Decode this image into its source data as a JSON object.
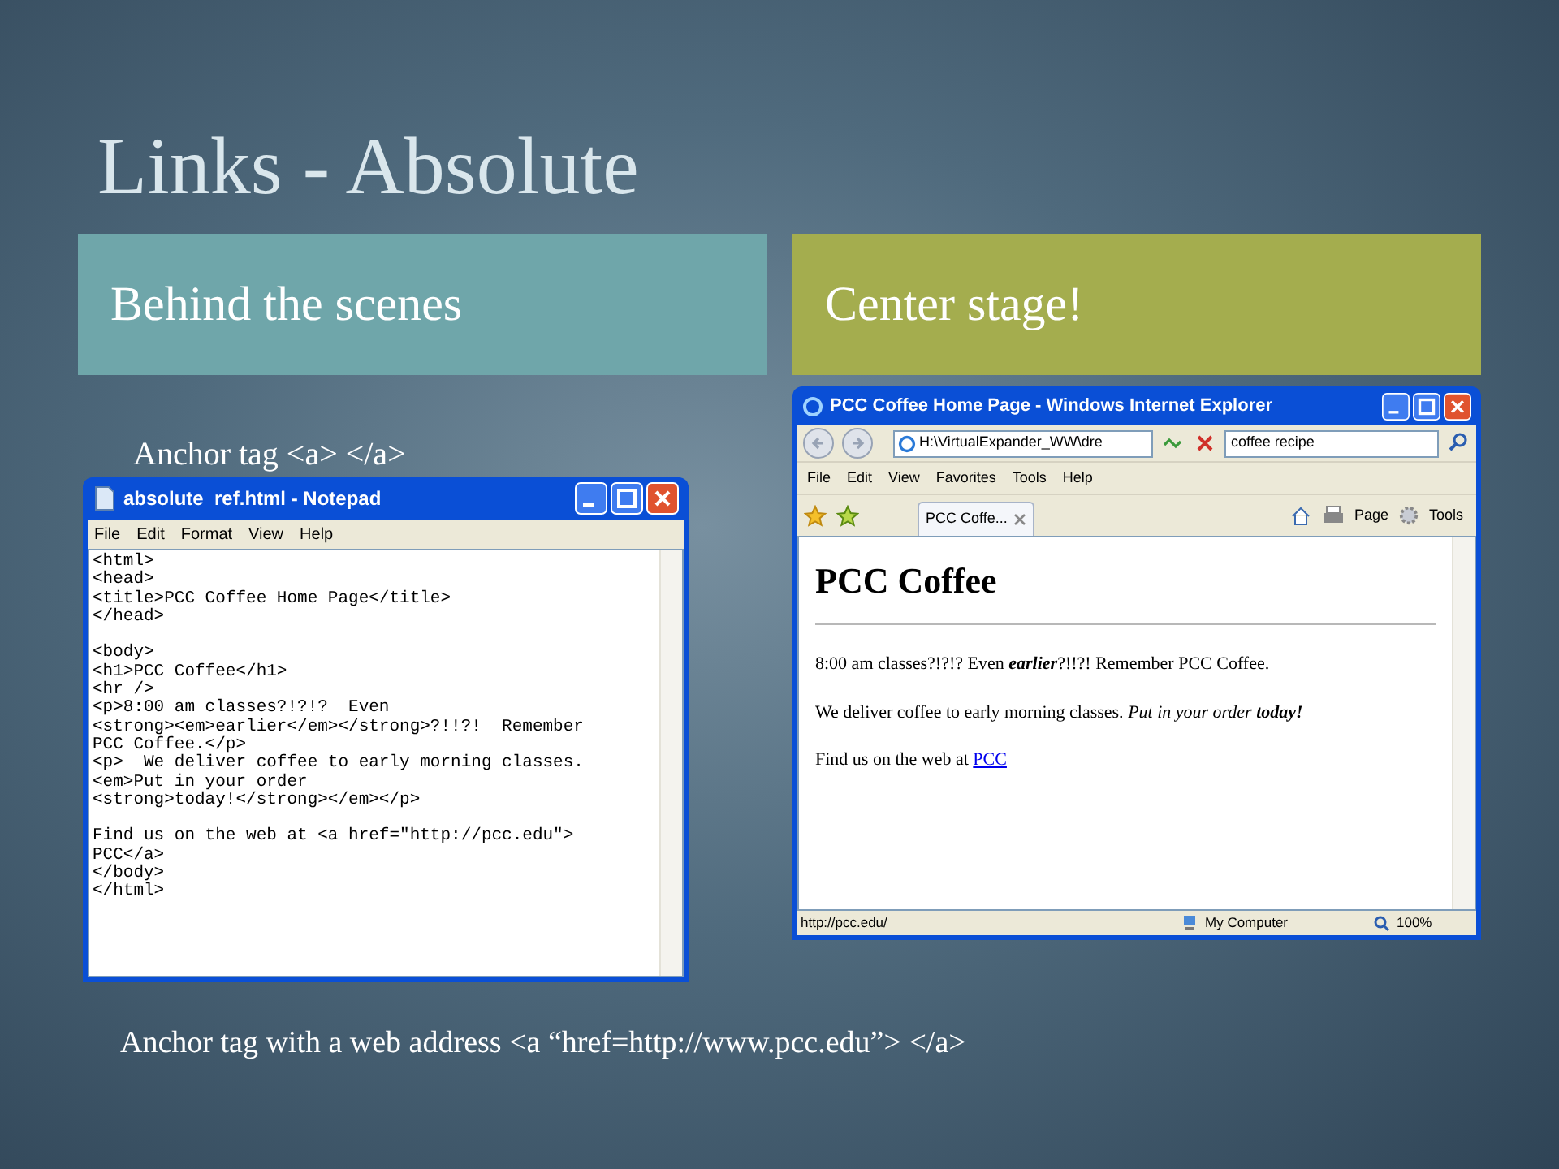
{
  "slide": {
    "title": "Links - Absolute"
  },
  "columns": [
    {
      "heading": "Behind the scenes",
      "color": "#6fa6aa"
    },
    {
      "heading": "Center stage!",
      "color": "#a4ad4e"
    }
  ],
  "left_caption": "Anchor tag <a> </a>",
  "notepad": {
    "title": "absolute_ref.html - Notepad",
    "menu": [
      "File",
      "Edit",
      "Format",
      "View",
      "Help"
    ],
    "blocks": [
      [
        "<html>",
        "<head>",
        "<title>PCC Coffee Home Page</title>",
        "</head>"
      ],
      [
        "<body>",
        "<h1>PCC Coffee</h1>",
        "<hr />",
        "<p>8:00 am classes?!?!?  Even",
        "<strong><em>earlier</em></strong>?!!?!  Remember",
        "PCC Coffee.</p>",
        "<p>  We deliver coffee to early morning classes.",
        "<em>Put in your order",
        "<strong>today!</strong></em></p>"
      ],
      [
        "Find us on the web at <a href=\"http://pcc.edu\">",
        "PCC</a>",
        "</body>",
        "</html>"
      ]
    ]
  },
  "browser": {
    "title": "PCC Coffee Home Page - Windows Internet Explorer",
    "address": "H:\\VirtualExpander_WW\\dre",
    "search": "coffee recipe",
    "menu": [
      "File",
      "Edit",
      "View",
      "Favorites",
      "Tools",
      "Help"
    ],
    "tab": "PCC Coffe...",
    "toolbar": [
      "Page",
      "Tools"
    ],
    "page": {
      "heading": "PCC Coffee",
      "paragraphs": [
        [
          {
            "kind": "plain",
            "text": "8:00 am classes?!?!? Even "
          },
          {
            "kind": "bold-italic",
            "text": "earlier"
          },
          {
            "kind": "plain",
            "text": "?!!?! Remember PCC Coffee."
          }
        ],
        [
          {
            "kind": "plain",
            "text": "We deliver coffee to early morning classes. "
          },
          {
            "kind": "italic",
            "text": "Put in your order "
          },
          {
            "kind": "bold-italic",
            "text": "today!"
          }
        ],
        [
          {
            "kind": "plain",
            "text": "Find us on the web at "
          },
          {
            "kind": "link",
            "text": "PCC"
          }
        ]
      ]
    },
    "status": {
      "url": "http://pcc.edu/",
      "zone": "My Computer",
      "zoom": "100%"
    }
  },
  "bottom_caption": "Anchor tag with a web address <a “href=http://www.pcc.edu”> </a>"
}
